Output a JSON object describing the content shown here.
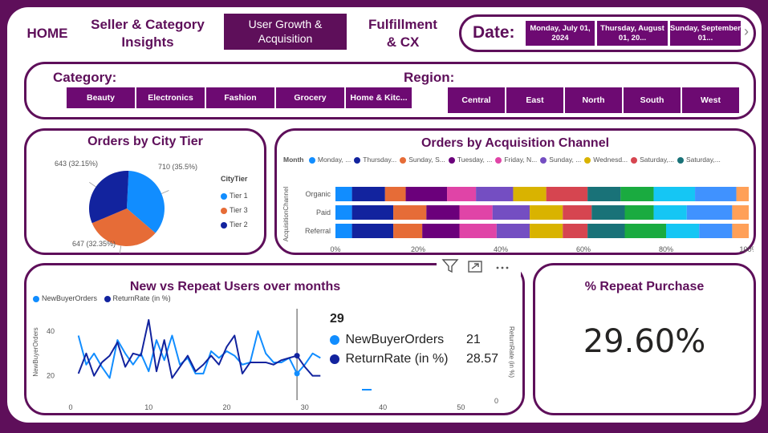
{
  "nav": {
    "home": "HOME",
    "seller": "Seller & Category Insights",
    "user_growth": "User Growth & Acquisition",
    "fulfillment": "Fulfillment & CX"
  },
  "date": {
    "label": "Date:",
    "options": [
      "Monday, July 01, 2024",
      "Thursday, August 01, 20...",
      "Sunday, September 01..."
    ],
    "next_icon": "chevron-right-icon"
  },
  "filters": {
    "category_label": "Category:",
    "categories": [
      "Beauty",
      "Electronics",
      "Fashion",
      "Grocery",
      "Home & Kitc..."
    ],
    "region_label": "Region:",
    "regions": [
      "Central",
      "East",
      "North",
      "South",
      "West"
    ]
  },
  "colors": {
    "brand": "#5e0f5a",
    "tier1": "#118dff",
    "tier3": "#e66c37",
    "tier2": "#12239e"
  },
  "pie": {
    "title": "Orders by City Tier",
    "legend_title": "CityTier",
    "legend": [
      "Tier 1",
      "Tier 3",
      "Tier 2"
    ],
    "labels": [
      "710 (35.5%)",
      "647 (32.35%)",
      "643 (32.15%)"
    ],
    "chart_data": {
      "type": "pie",
      "title": "Orders by City Tier",
      "slices": [
        {
          "name": "Tier 1",
          "value": 710,
          "percent": 35.5
        },
        {
          "name": "Tier 3",
          "value": 647,
          "percent": 32.35
        },
        {
          "name": "Tier 2",
          "value": 643,
          "percent": 32.15
        }
      ]
    }
  },
  "channel": {
    "title": "Orders by Acquisition Channel",
    "legend_title": "Month",
    "legend": [
      "Monday, ...",
      "Thursday...",
      "Sunday, S...",
      "Tuesday, ...",
      "Friday, N...",
      "Sunday, ...",
      "Wednesd...",
      "Saturday,...",
      "Saturday,..."
    ],
    "ylabel": "AcquisitionChannel",
    "xticks": [
      "0%",
      "20%",
      "40%",
      "60%",
      "80%",
      "100%"
    ],
    "chart_data": {
      "type": "bar",
      "orientation": "horizontal-stacked-100",
      "categories": [
        "Organic",
        "Paid",
        "Referral"
      ],
      "xlim": [
        0,
        100
      ],
      "series": [
        {
          "name": "Monday, ...",
          "color": "#118dff",
          "values": [
            4,
            4,
            4
          ]
        },
        {
          "name": "Thursday...",
          "color": "#12239e",
          "values": [
            8,
            10,
            10
          ]
        },
        {
          "name": "Sunday, S...",
          "color": "#e66c37",
          "values": [
            5,
            8,
            7
          ]
        },
        {
          "name": "Tuesday, ...",
          "color": "#6b007b",
          "values": [
            10,
            8,
            9
          ]
        },
        {
          "name": "Friday, N...",
          "color": "#e044a7",
          "values": [
            7,
            8,
            9
          ]
        },
        {
          "name": "Sunday, ...",
          "color": "#744ec2",
          "values": [
            9,
            9,
            8
          ]
        },
        {
          "name": "Wednesd...",
          "color": "#d9b300",
          "values": [
            8,
            8,
            8
          ]
        },
        {
          "name": "Saturday,...",
          "color": "#d64550",
          "values": [
            10,
            7,
            6
          ]
        },
        {
          "name": "Saturday,...",
          "color": "#197278",
          "values": [
            8,
            8,
            9
          ]
        },
        {
          "name": "",
          "color": "#1aab40",
          "values": [
            8,
            7,
            10
          ]
        },
        {
          "name": "",
          "color": "#15c6f4",
          "values": [
            10,
            8,
            8
          ]
        },
        {
          "name": "",
          "color": "#4092ff",
          "values": [
            10,
            11,
            8
          ]
        },
        {
          "name": "",
          "color": "#ffa058",
          "values": [
            3,
            4,
            4
          ]
        }
      ]
    }
  },
  "lines": {
    "title": "New vs Repeat Users over months",
    "legend": [
      "NewBuyerOrders",
      "ReturnRate (in %)"
    ],
    "ylabel": "NewBuyerOrders",
    "y2label": "ReturnRate (in %)",
    "xticks": [
      "0",
      "10",
      "20",
      "30",
      "40",
      "50"
    ],
    "yticks": [
      "20",
      "40"
    ],
    "y2ticks": [
      "0"
    ],
    "tooltip": {
      "x": "29",
      "rows": [
        {
          "name": "NewBuyerOrders",
          "value": "21"
        },
        {
          "name": "ReturnRate (in %)",
          "value": "28.57"
        }
      ]
    },
    "header_icons": [
      "filter-icon",
      "focus-mode-icon",
      "more-options-icon"
    ],
    "chart_data": {
      "type": "line",
      "title": "New vs Repeat Users over months",
      "xlim": [
        0,
        55
      ],
      "ylim": [
        12,
        50
      ],
      "x": [
        1,
        2,
        3,
        4,
        5,
        6,
        7,
        8,
        9,
        10,
        11,
        12,
        13,
        14,
        15,
        16,
        17,
        18,
        19,
        20,
        21,
        22,
        23,
        24,
        25,
        26,
        27,
        28,
        29,
        30,
        31,
        32
      ],
      "series": [
        {
          "name": "NewBuyerOrders",
          "color": "#118dff",
          "values": [
            38,
            25,
            30,
            24,
            19,
            36,
            30,
            25,
            30,
            22,
            36,
            27,
            38,
            25,
            28,
            21,
            21,
            31,
            28,
            31,
            29,
            25,
            26,
            40,
            30,
            26,
            26,
            28,
            21,
            25,
            30,
            28
          ]
        },
        {
          "name": "ReturnRate (in %)",
          "color": "#12239e",
          "values": [
            21,
            30,
            20,
            26,
            29,
            35,
            24,
            30,
            29,
            45,
            22,
            36,
            19,
            24,
            29,
            22,
            25,
            29,
            25,
            33,
            38,
            21,
            26,
            26,
            26,
            25,
            27,
            28,
            29,
            24,
            20,
            20
          ]
        }
      ]
    }
  },
  "kpi": {
    "title": "% Repeat Purchase",
    "value": "29.60%"
  }
}
